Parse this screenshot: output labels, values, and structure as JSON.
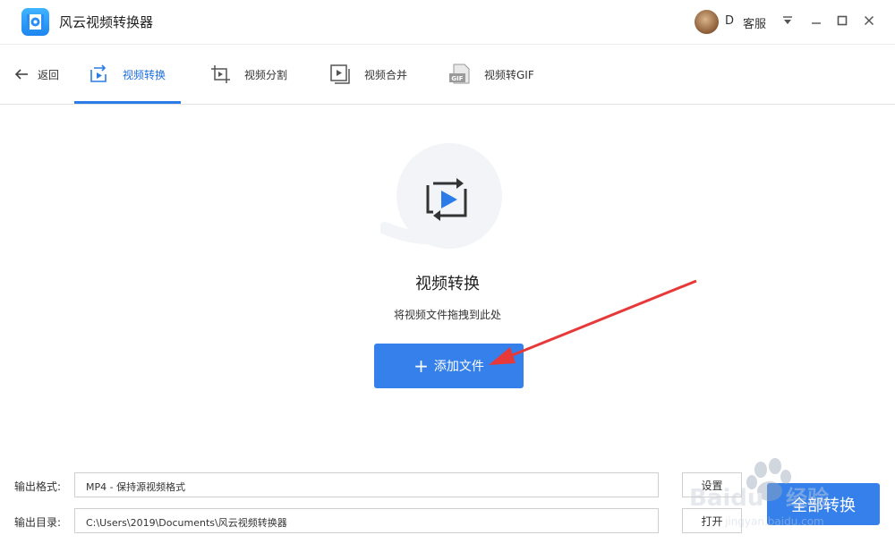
{
  "window": {
    "title": "风云视频转换器",
    "user_initial": "D",
    "service_label": "客服"
  },
  "nav": {
    "back_label": "返回",
    "tabs": [
      {
        "label": "视频转换",
        "icon": "convert-icon",
        "active": true
      },
      {
        "label": "视频分割",
        "icon": "crop-icon",
        "active": false
      },
      {
        "label": "视频合并",
        "icon": "merge-icon",
        "active": false
      },
      {
        "label": "视频转GIF",
        "icon": "gif-icon",
        "active": false
      }
    ]
  },
  "main": {
    "title": "视频转换",
    "subtitle": "将视频文件拖拽到此处",
    "add_button_label": "添加文件"
  },
  "bottom": {
    "format_label": "输出格式:",
    "format_value": "MP4 - 保持源视频格式",
    "settings_button": "设置",
    "dir_label": "输出目录:",
    "dir_value": "C:\\Users\\2019\\Documents\\风云视频转换器",
    "open_button": "打开",
    "convert_all_button": "全部转换"
  },
  "colors": {
    "accent": "#3580ea",
    "active_tab_text": "#1d6fe0",
    "annotation_arrow": "#e8393a"
  }
}
